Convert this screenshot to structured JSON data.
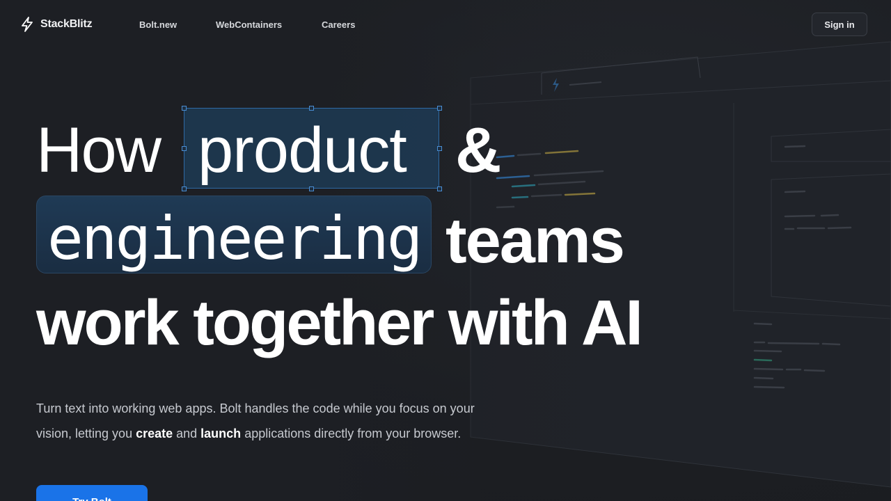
{
  "brand": {
    "name": "StackBlitz",
    "icon": "bolt-icon"
  },
  "nav": {
    "items": [
      "Bolt.new",
      "WebContainers",
      "Careers"
    ],
    "signin_label": "Sign in"
  },
  "hero": {
    "word_how": "How",
    "word_product": "product",
    "word_amp": "&",
    "word_engineering": "engineering",
    "word_teams": "teams",
    "line3": "work together with AI",
    "paragraph": {
      "part1": "Turn text into working web apps. Bolt handles the code while you focus on your vision, letting you ",
      "bold1": "create",
      "part2": " and ",
      "bold2": "launch",
      "part3": " applications directly from your browser."
    },
    "cta_label": "Try Bolt"
  },
  "colors": {
    "background": "#1d1f24",
    "accent": "#1a73e8",
    "selection": "#2e6aa5",
    "chip": "#1f3a55"
  }
}
